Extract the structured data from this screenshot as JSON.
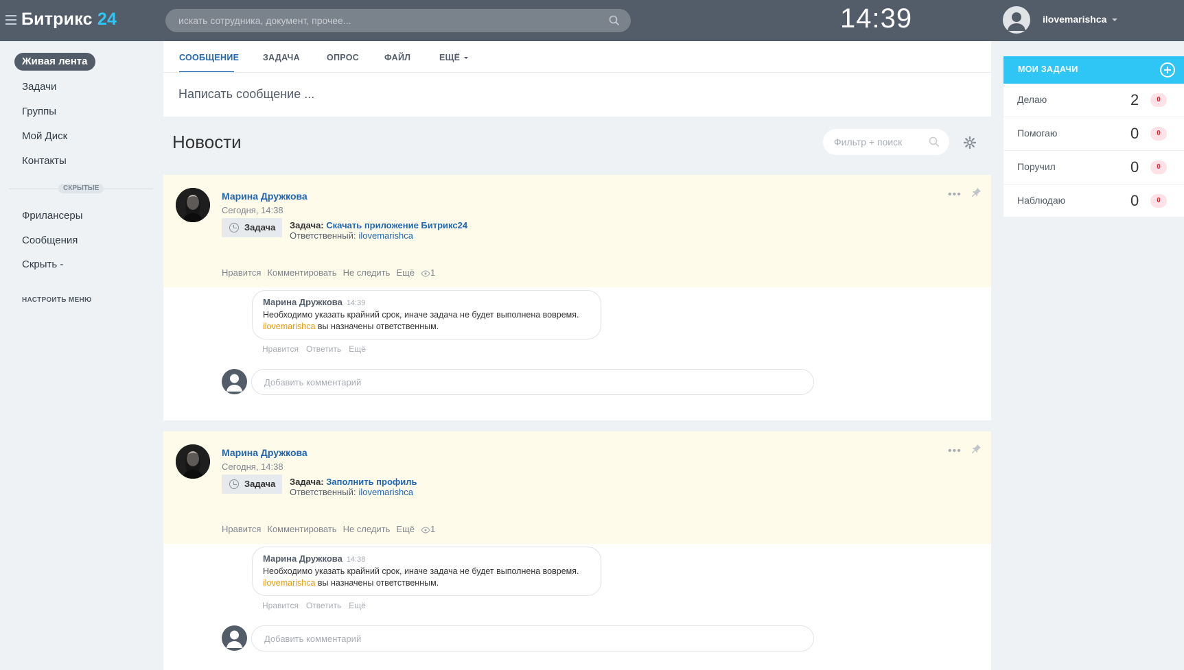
{
  "header": {
    "logo_text": "Битрикс",
    "logo_num": "24",
    "search_placeholder": "искать сотрудника, документ, прочее...",
    "clock": "14:39",
    "user_name": "ilovemarishca"
  },
  "left_menu": {
    "items": [
      "Живая лента",
      "Задачи",
      "Группы",
      "Мой Диск",
      "Контакты"
    ],
    "hidden_label": "СКРЫТЫЕ",
    "hidden_items": [
      "Фрилансеры",
      "Сообщения",
      "Скрыть -"
    ],
    "settings": "НАСТРОИТЬ МЕНЮ"
  },
  "composer": {
    "tabs": [
      "СООБЩЕНИЕ",
      "ЗАДАЧА",
      "ОПРОС",
      "ФАЙЛ",
      "ЕЩЁ"
    ],
    "placeholder": "Написать сообщение ..."
  },
  "news": {
    "title": "Новости",
    "filter_placeholder": "Фильтр + поиск"
  },
  "posts": [
    {
      "author": "Марина Дружкова",
      "time": "Сегодня, 14:38",
      "badge": "Задача",
      "task_label": "Задача:",
      "task_title": "Скачать приложение Битрикс24",
      "responsible_label": "Ответственный:",
      "responsible": "ilovemarishca",
      "actions": [
        "Нравится",
        "Комментировать",
        "Не следить",
        "Ещё"
      ],
      "views": "1",
      "comment": {
        "author": "Марина Дружкова",
        "time": "14:39",
        "text": "Необходимо указать крайний срок, иначе задача не будет выполнена вовремя.",
        "mention": "ilovemarishca",
        "text2": " вы назначены ответственным.",
        "actions": [
          "Нравится",
          "Ответить",
          "Ещё"
        ]
      },
      "add_comment_placeholder": "Добавить комментарий"
    },
    {
      "author": "Марина Дружкова",
      "time": "Сегодня, 14:38",
      "badge": "Задача",
      "task_label": "Задача:",
      "task_title": "Заполнить профиль",
      "responsible_label": "Ответственный:",
      "responsible": "ilovemarishca",
      "actions": [
        "Нравится",
        "Комментировать",
        "Не следить",
        "Ещё"
      ],
      "views": "1",
      "comment": {
        "author": "Марина Дружкова",
        "time": "14:38",
        "text": "Необходимо указать крайний срок, иначе задача не будет выполнена вовремя.",
        "mention": "ilovemarishca",
        "text2": " вы назначены ответственным.",
        "actions": [
          "Нравится",
          "Ответить",
          "Ещё"
        ]
      },
      "add_comment_placeholder": "Добавить комментарий"
    }
  ],
  "my_tasks": {
    "title": "МОИ ЗАДАЧИ",
    "rows": [
      {
        "label": "Делаю",
        "count": "2",
        "badge": "0"
      },
      {
        "label": "Помогаю",
        "count": "0",
        "badge": "0"
      },
      {
        "label": "Поручил",
        "count": "0",
        "badge": "0"
      },
      {
        "label": "Наблюдаю",
        "count": "0",
        "badge": "0"
      }
    ]
  },
  "colors": {
    "header_bg": "#535c69",
    "accent": "#2fc6f6",
    "link": "#2067b0",
    "post_highlight": "#fffbeb",
    "mention": "#e89b06"
  }
}
